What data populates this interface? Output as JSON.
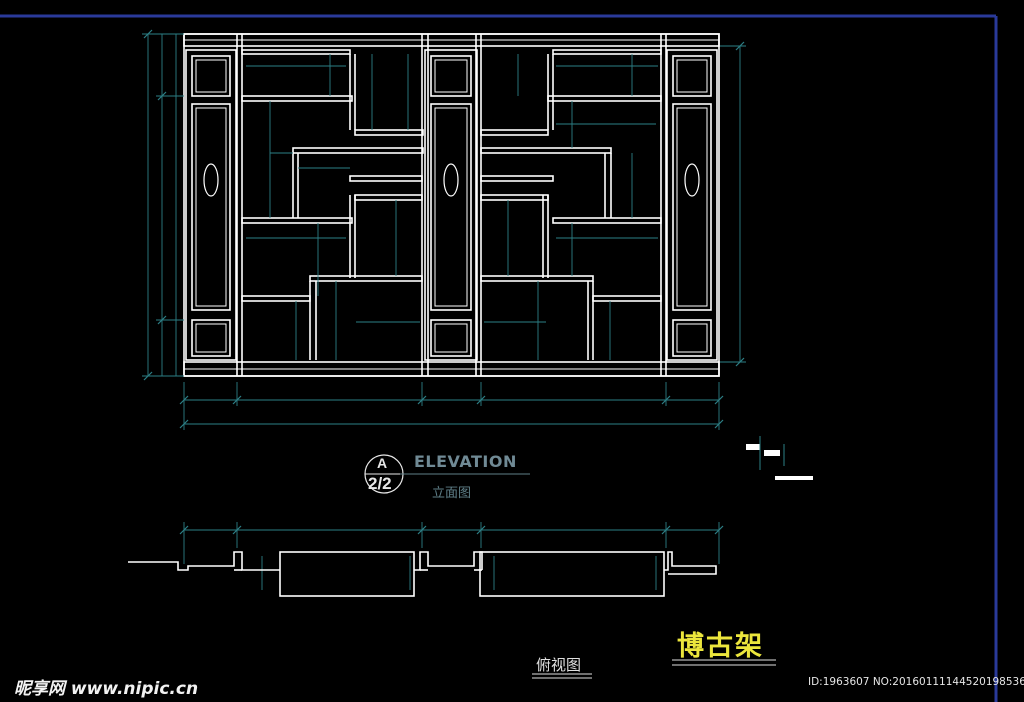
{
  "drawing": {
    "elevation_title": "ELEVATION",
    "elevation_subtitle": "立面图",
    "section_ref_top": "A",
    "section_ref_bottom": "2/2",
    "plan_title": "俯视图",
    "main_title": "博古架",
    "title_color": "#ece63c",
    "line_color": "#ffffff",
    "dimension_color": "#2d7f86",
    "frame_border_color": "#2a3a9a"
  },
  "watermark": {
    "site_text": "昵享网 www.nipic.cn",
    "id_text": "ID:1963607 NO:20160111144520198536"
  }
}
